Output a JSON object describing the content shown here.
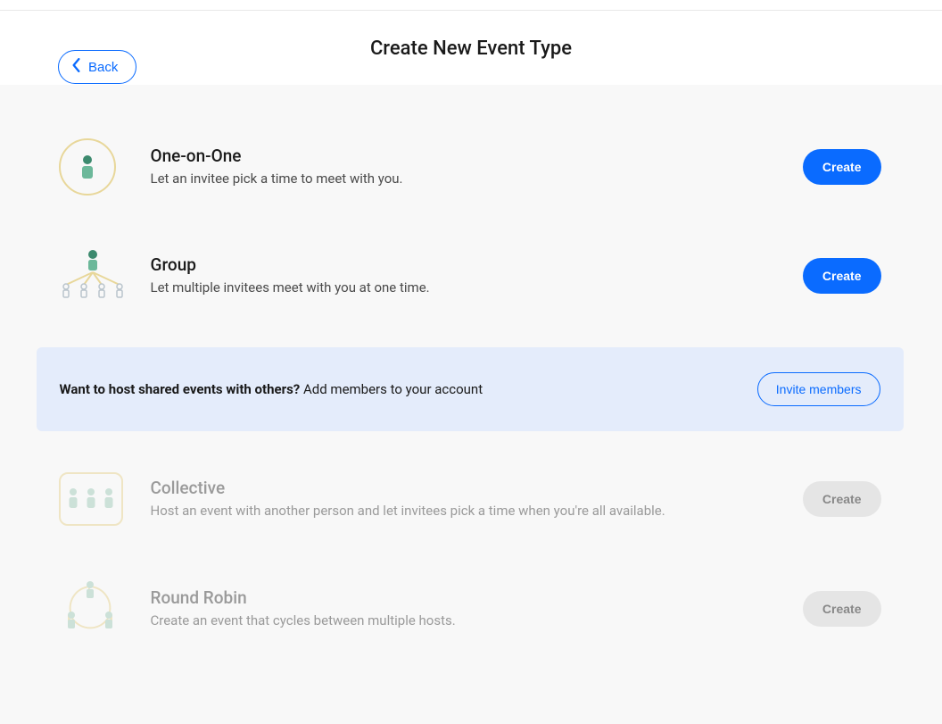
{
  "header": {
    "back_label": "Back",
    "title": "Create New Event Type"
  },
  "event_types": [
    {
      "key": "one_on_one",
      "title": "One-on-One",
      "desc": "Let an invitee pick a time to meet with you.",
      "create_label": "Create",
      "enabled": true
    },
    {
      "key": "group",
      "title": "Group",
      "desc": "Let multiple invitees meet with you at one time.",
      "create_label": "Create",
      "enabled": true
    },
    {
      "key": "collective",
      "title": "Collective",
      "desc": "Host an event with another person and let invitees pick a time when you're all available.",
      "create_label": "Create",
      "enabled": false
    },
    {
      "key": "round_robin",
      "title": "Round Robin",
      "desc": "Create an event that cycles between multiple hosts.",
      "create_label": "Create",
      "enabled": false
    }
  ],
  "banner": {
    "prompt_bold": "Want to host shared events with others?",
    "prompt_rest": " Add members to your account",
    "button_label": "Invite members"
  }
}
